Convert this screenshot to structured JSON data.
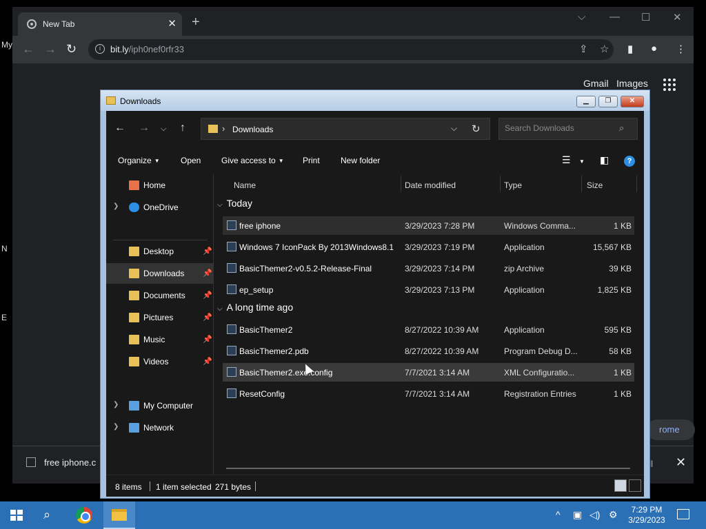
{
  "desktop": {
    "labels": [
      "My",
      "N",
      "E"
    ]
  },
  "chrome": {
    "tab_title": "New Tab",
    "url_host": "bit.ly",
    "url_path": "/iph0nef0rfr33",
    "gmail": "Gmail",
    "images": "Images",
    "pill_text": "rome",
    "download_item": "free iphone.c",
    "show_all": "all"
  },
  "explorer": {
    "title": "Downloads",
    "address": "Downloads",
    "search_placeholder": "Search Downloads",
    "commands": {
      "organize": "Organize",
      "open": "Open",
      "give_access": "Give access to",
      "print": "Print",
      "new_folder": "New folder"
    },
    "nav": [
      {
        "label": "Home",
        "icon": "home-icon",
        "color": "#e8734a",
        "expand": false,
        "pin": false
      },
      {
        "label": "OneDrive",
        "icon": "cloud-icon",
        "color": "#2d8ee6",
        "expand": true,
        "pin": false
      },
      {
        "label": "Desktop",
        "icon": "folder-icon",
        "color": "#e8c058",
        "expand": false,
        "pin": true
      },
      {
        "label": "Downloads",
        "icon": "folder-icon",
        "color": "#e8c058",
        "expand": false,
        "pin": true
      },
      {
        "label": "Documents",
        "icon": "folder-icon",
        "color": "#e8c058",
        "expand": false,
        "pin": true
      },
      {
        "label": "Pictures",
        "icon": "folder-icon",
        "color": "#e8c058",
        "expand": false,
        "pin": true
      },
      {
        "label": "Music",
        "icon": "folder-icon",
        "color": "#e8c058",
        "expand": false,
        "pin": true
      },
      {
        "label": "Videos",
        "icon": "folder-icon",
        "color": "#e8c058",
        "expand": false,
        "pin": true
      },
      {
        "label": "My Computer",
        "icon": "computer-icon",
        "color": "#5aa0e0",
        "expand": true,
        "pin": false
      },
      {
        "label": "Network",
        "icon": "network-icon",
        "color": "#5aa0e0",
        "expand": true,
        "pin": false
      }
    ],
    "columns": {
      "name": "Name",
      "date": "Date modified",
      "type": "Type",
      "size": "Size"
    },
    "groups": [
      {
        "label": "Today",
        "files": [
          {
            "name": "free iphone",
            "date": "3/29/2023 7:28 PM",
            "type": "Windows Comma...",
            "size": "1 KB"
          },
          {
            "name": "Windows 7 IconPack By 2013Windows8.1",
            "date": "3/29/2023 7:19 PM",
            "type": "Application",
            "size": "15,567 KB"
          },
          {
            "name": "BasicThemer2-v0.5.2-Release-Final",
            "date": "3/29/2023 7:14 PM",
            "type": "zip Archive",
            "size": "39 KB"
          },
          {
            "name": "ep_setup",
            "date": "3/29/2023 7:13 PM",
            "type": "Application",
            "size": "1,825 KB"
          }
        ]
      },
      {
        "label": "A long time ago",
        "files": [
          {
            "name": "BasicThemer2",
            "date": "8/27/2022 10:39 AM",
            "type": "Application",
            "size": "595 KB"
          },
          {
            "name": "BasicThemer2.pdb",
            "date": "8/27/2022 10:39 AM",
            "type": "Program Debug D...",
            "size": "58 KB"
          },
          {
            "name": "BasicThemer2.exe.config",
            "date": "7/7/2021 3:14 AM",
            "type": "XML Configuratio...",
            "size": "1 KB"
          },
          {
            "name": "ResetConfig",
            "date": "7/7/2021 3:14 AM",
            "type": "Registration Entries",
            "size": "1 KB"
          }
        ]
      }
    ],
    "status": {
      "items": "8 items",
      "selected": "1 item selected",
      "size": "271 bytes"
    }
  },
  "taskbar": {
    "time": "7:29 PM",
    "date": "3/29/2023"
  }
}
